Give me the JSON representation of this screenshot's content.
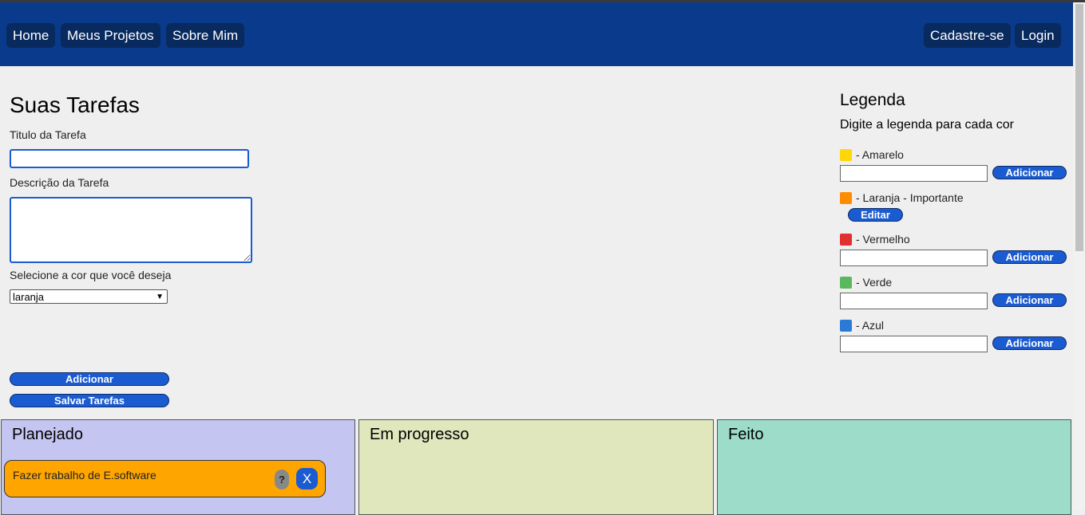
{
  "nav": {
    "left": [
      "Home",
      "Meus Projetos",
      "Sobre Mim"
    ],
    "right": [
      "Cadastre-se",
      "Login"
    ]
  },
  "form": {
    "title": "Suas Tarefas",
    "task_title_label": "Titulo da Tarefa",
    "task_title_value": "",
    "task_desc_label": "Descrição da Tarefa",
    "task_desc_value": "",
    "color_label": "Selecione a cor que você deseja",
    "color_selected": "laranja",
    "add_label": "Adicionar",
    "save_label": "Salvar Tarefas"
  },
  "legend": {
    "title": "Legenda",
    "subtitle": "Digite a legenda para cada cor",
    "items": [
      {
        "swatch": "#ffd60a",
        "label": "- Amarelo",
        "action": "Adicionar"
      },
      {
        "swatch": "#ff8c00",
        "label": "- Laranja - Importante",
        "action": "Editar"
      },
      {
        "swatch": "#e03030",
        "label": "- Vermelho",
        "action": "Adicionar"
      },
      {
        "swatch": "#5cb85c",
        "label": "- Verde",
        "action": "Adicionar"
      },
      {
        "swatch": "#2b7bd6",
        "label": "- Azul",
        "action": "Adicionar"
      }
    ]
  },
  "board": {
    "columns": [
      {
        "title": "Planejado",
        "color": "#c5c5f2"
      },
      {
        "title": "Em progresso",
        "color": "#e0e7bd"
      },
      {
        "title": "Feito",
        "color": "#9cdcc9"
      }
    ],
    "task": {
      "title": "Fazer trabalho de E.software",
      "help": "?",
      "close": "X",
      "color": "#ffa500"
    }
  }
}
